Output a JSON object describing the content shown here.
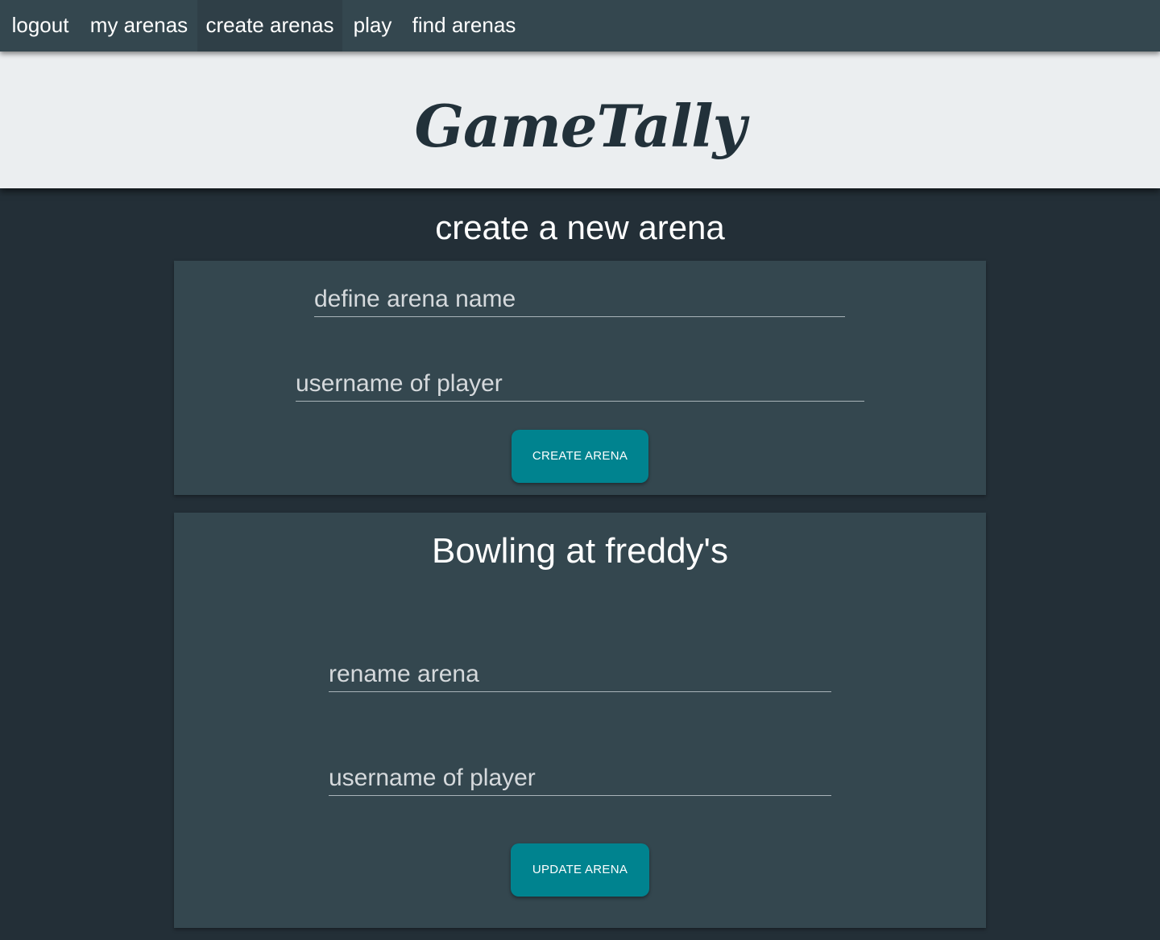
{
  "nav": {
    "items": [
      {
        "label": "logout"
      },
      {
        "label": "my arenas"
      },
      {
        "label": "create arenas",
        "active": true
      },
      {
        "label": "play"
      },
      {
        "label": "find arenas"
      }
    ]
  },
  "banner": {
    "logo_text": "GameTally"
  },
  "page_title": "create a new arena",
  "create_form": {
    "arena_name_placeholder": "define arena name",
    "player_placeholder": "username of player",
    "submit_label": "CREATE ARENA"
  },
  "arena_card": {
    "title": "Bowling at freddy's",
    "rename_placeholder": "rename arena",
    "player_placeholder": "username of player",
    "submit_label": "UPDATE ARENA"
  },
  "colors": {
    "background": "#232f37",
    "nav": "#34474f",
    "banner": "#ebeef0",
    "card": "#34474f",
    "button": "#00838f"
  }
}
